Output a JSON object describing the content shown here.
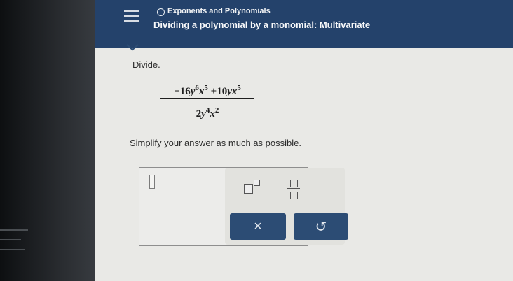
{
  "header": {
    "topic": "Exponents and Polynomials",
    "title": "Dividing a polynomial by a monomial: Multivariate"
  },
  "problem": {
    "prompt": "Divide.",
    "numerator": {
      "term1": {
        "coef": "−16",
        "v1": "y",
        "e1": "6",
        "v2": "x",
        "e2": "5"
      },
      "op": "+",
      "term2": {
        "coef": "10",
        "v1": "y",
        "v2": "x",
        "e2": "5"
      }
    },
    "denominator": {
      "coef": "2",
      "v1": "y",
      "e1": "4",
      "v2": "x",
      "e2": "2"
    },
    "instruction": "Simplify your answer as much as possible."
  },
  "answer": {
    "value": ""
  },
  "tools": {
    "exponent_icon": "exponent-template-icon",
    "fraction_icon": "fraction-template-icon",
    "clear_label": "×",
    "undo_label": "↺"
  },
  "colors": {
    "header_bg": "#24426b",
    "button_bg": "#2c4c74",
    "page_bg": "#e9e9e6"
  }
}
